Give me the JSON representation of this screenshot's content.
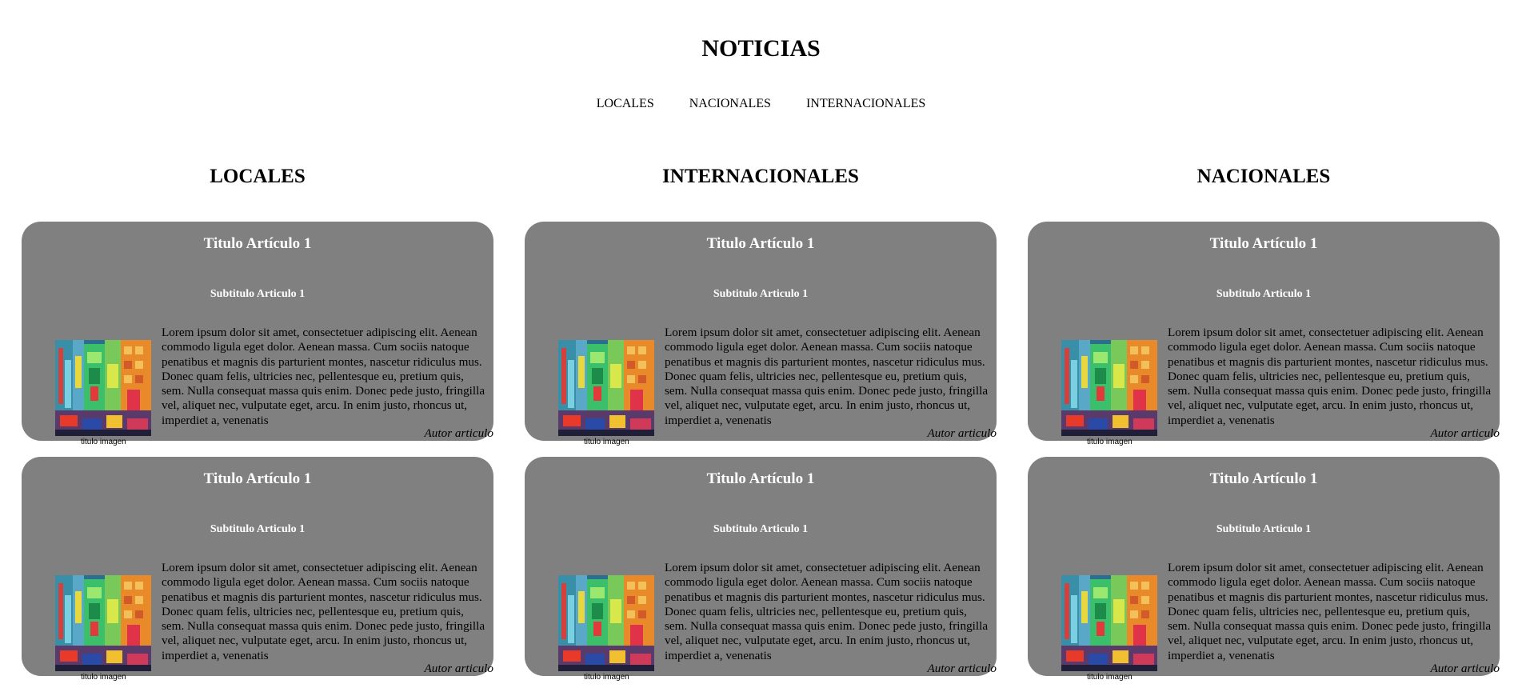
{
  "page": {
    "title": "NOTICIAS"
  },
  "nav": [
    "LOCALES",
    "NACIONALES",
    "INTERNACIONALES"
  ],
  "sections": [
    {
      "heading": "LOCALES",
      "articles": [
        {
          "title": "Titulo Artículo 1",
          "subtitle": "Subtitulo Articulo 1",
          "body": "Lorem ipsum dolor sit amet, consectetuer adipiscing elit. Aenean commodo ligula eget dolor. Aenean massa. Cum sociis natoque penatibus et magnis dis parturient montes, nascetur ridiculus mus. Donec quam felis, ultricies nec, pellentesque eu, pretium quis, sem. Nulla consequat massa quis enim. Donec pede justo, fringilla vel, aliquet nec, vulputate eget, arcu. In enim justo, rhoncus ut, imperdiet a, venenatis",
          "image_caption": "titulo imagen",
          "author": "Autor articulo"
        },
        {
          "title": "Titulo Artículo 1",
          "subtitle": "Subtitulo Articulo 1",
          "body": "Lorem ipsum dolor sit amet, consectetuer adipiscing elit. Aenean commodo ligula eget dolor. Aenean massa. Cum sociis natoque penatibus et magnis dis parturient montes, nascetur ridiculus mus. Donec quam felis, ultricies nec, pellentesque eu, pretium quis, sem. Nulla consequat massa quis enim. Donec pede justo, fringilla vel, aliquet nec, vulputate eget, arcu. In enim justo, rhoncus ut, imperdiet a, venenatis",
          "image_caption": "titulo imagen",
          "author": "Autor articulo"
        }
      ]
    },
    {
      "heading": "INTERNACIONALES",
      "articles": [
        {
          "title": "Titulo Artículo 1",
          "subtitle": "Subtitulo Articulo 1",
          "body": "Lorem ipsum dolor sit amet, consectetuer adipiscing elit. Aenean commodo ligula eget dolor. Aenean massa. Cum sociis natoque penatibus et magnis dis parturient montes, nascetur ridiculus mus. Donec quam felis, ultricies nec, pellentesque eu, pretium quis, sem. Nulla consequat massa quis enim. Donec pede justo, fringilla vel, aliquet nec, vulputate eget, arcu. In enim justo, rhoncus ut, imperdiet a, venenatis",
          "image_caption": "titulo imagen",
          "author": "Autor articulo"
        },
        {
          "title": "Titulo Artículo 1",
          "subtitle": "Subtitulo Articulo 1",
          "body": "Lorem ipsum dolor sit amet, consectetuer adipiscing elit. Aenean commodo ligula eget dolor. Aenean massa. Cum sociis natoque penatibus et magnis dis parturient montes, nascetur ridiculus mus. Donec quam felis, ultricies nec, pellentesque eu, pretium quis, sem. Nulla consequat massa quis enim. Donec pede justo, fringilla vel, aliquet nec, vulputate eget, arcu. In enim justo, rhoncus ut, imperdiet a, venenatis",
          "image_caption": "titulo imagen",
          "author": "Autor articulo"
        }
      ]
    },
    {
      "heading": "NACIONALES",
      "articles": [
        {
          "title": "Titulo Artículo 1",
          "subtitle": "Subtitulo Articulo 1",
          "body": "Lorem ipsum dolor sit amet, consectetuer adipiscing elit. Aenean commodo ligula eget dolor. Aenean massa. Cum sociis natoque penatibus et magnis dis parturient montes, nascetur ridiculus mus. Donec quam felis, ultricies nec, pellentesque eu, pretium quis, sem. Nulla consequat massa quis enim. Donec pede justo, fringilla vel, aliquet nec, vulputate eget, arcu. In enim justo, rhoncus ut, imperdiet a, venenatis",
          "image_caption": "titulo imagen",
          "author": "Autor articulo"
        },
        {
          "title": "Titulo Artículo 1",
          "subtitle": "Subtitulo Articulo 1",
          "body": "Lorem ipsum dolor sit amet, consectetuer adipiscing elit. Aenean commodo ligula eget dolor. Aenean massa. Cum sociis natoque penatibus et magnis dis parturient montes, nascetur ridiculus mus. Donec quam felis, ultricies nec, pellentesque eu, pretium quis, sem. Nulla consequat massa quis enim. Donec pede justo, fringilla vel, aliquet nec, vulputate eget, arcu. In enim justo, rhoncus ut, imperdiet a, venenatis",
          "image_caption": "titulo imagen",
          "author": "Autor articulo"
        }
      ]
    }
  ],
  "colors": {
    "card_background": "#808080",
    "card_heading_text": "#ffffff",
    "page_background": "#ffffff"
  }
}
